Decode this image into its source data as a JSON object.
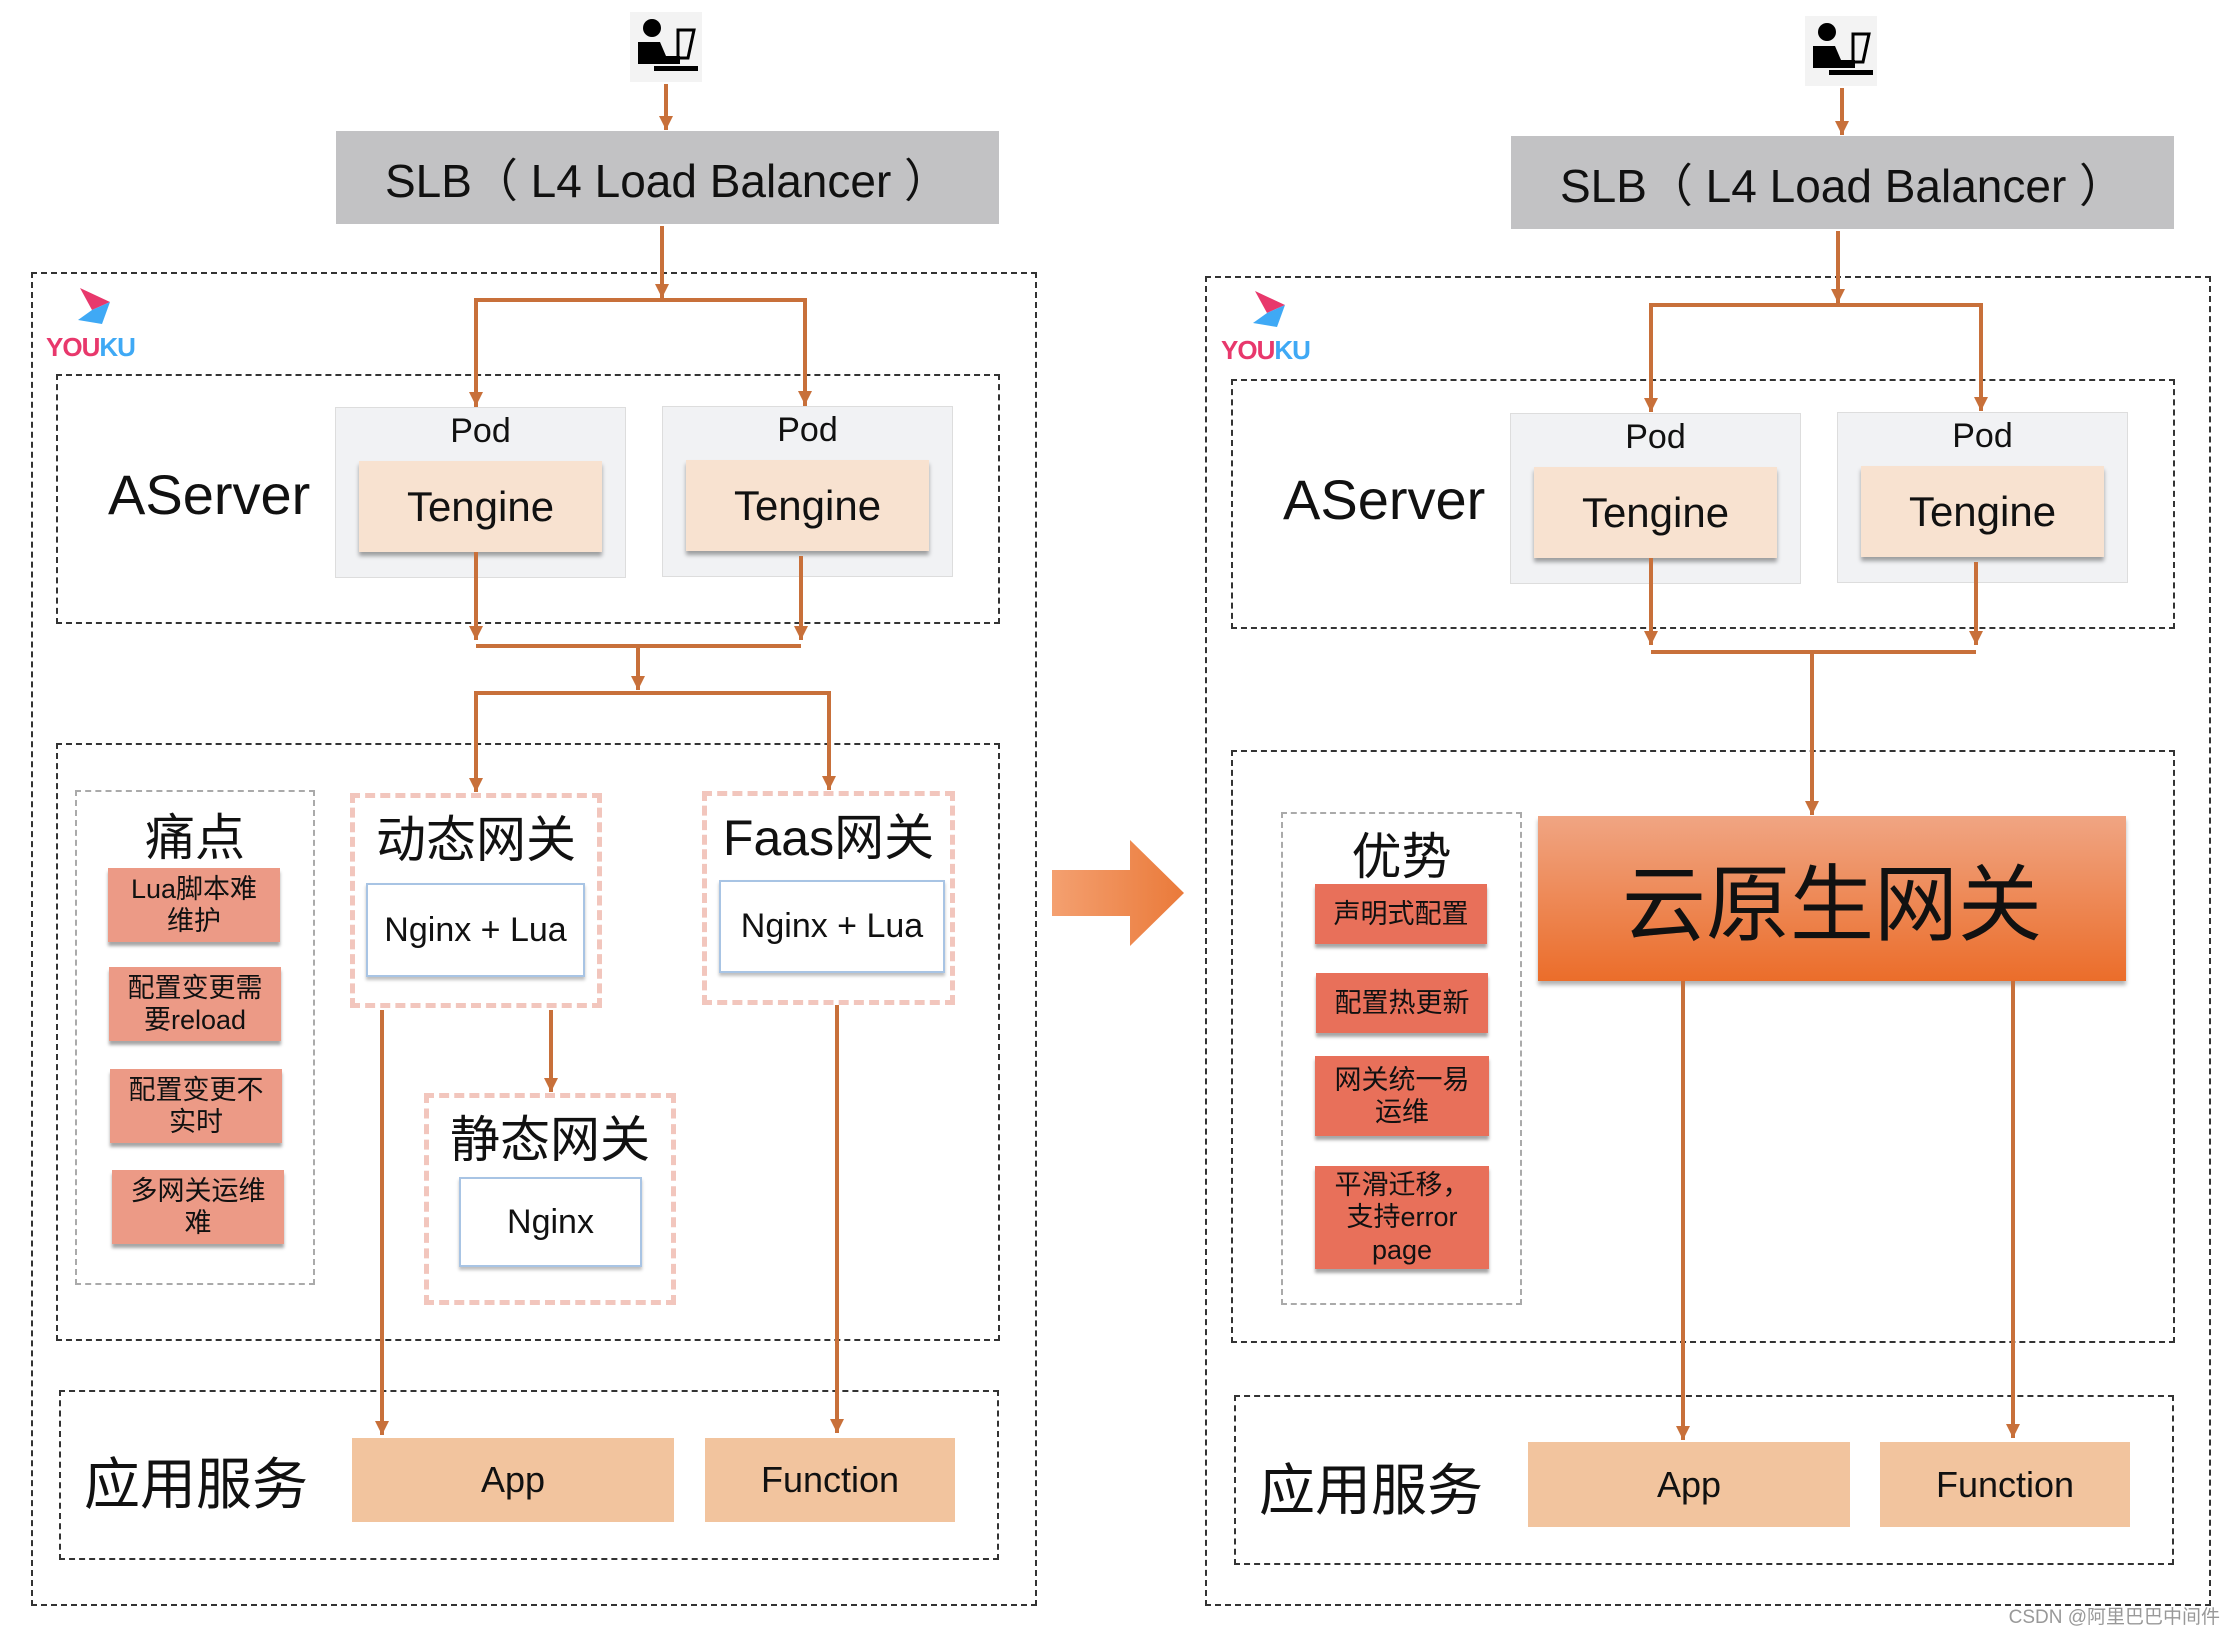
{
  "left": {
    "slb_label": "SLB（ L4 Load Balancer ）",
    "logo": {
      "you": "YOU",
      "ku": "KU"
    },
    "aserver_label": "AServer",
    "pods": [
      {
        "label": "Pod",
        "inner": "Tengine"
      },
      {
        "label": "Pod",
        "inner": "Tengine"
      }
    ],
    "pain_points": {
      "title": "痛点",
      "items": [
        "Lua脚本难\n维护",
        "配置变更需\n要reload",
        "配置变更不\n实时",
        "多网关运维\n难"
      ]
    },
    "dynamic_gateway": {
      "title": "动态网关",
      "inner": "Nginx + Lua"
    },
    "faas_gateway": {
      "title": "Faas网关",
      "inner": "Nginx + Lua"
    },
    "static_gateway": {
      "title": "静态网关",
      "inner": "Nginx"
    },
    "services_label": "应用服务",
    "services": [
      "App",
      "Function"
    ]
  },
  "right": {
    "slb_label": "SLB（ L4 Load Balancer ）",
    "logo": {
      "you": "YOU",
      "ku": "KU"
    },
    "aserver_label": "AServer",
    "pods": [
      {
        "label": "Pod",
        "inner": "Tengine"
      },
      {
        "label": "Pod",
        "inner": "Tengine"
      }
    ],
    "advantages": {
      "title": "优势",
      "items": [
        "声明式配置",
        "配置热更新",
        "网关统一易\n运维",
        "平滑迁移，\n支持error\npage"
      ]
    },
    "cloud_gateway": "云原生网关",
    "services_label": "应用服务",
    "services": [
      "App",
      "Function"
    ]
  },
  "colors": {
    "arrow": "#c8703a",
    "transition_arrow": "#ee8a4a"
  },
  "watermark": "CSDN @阿里巴巴中间件"
}
